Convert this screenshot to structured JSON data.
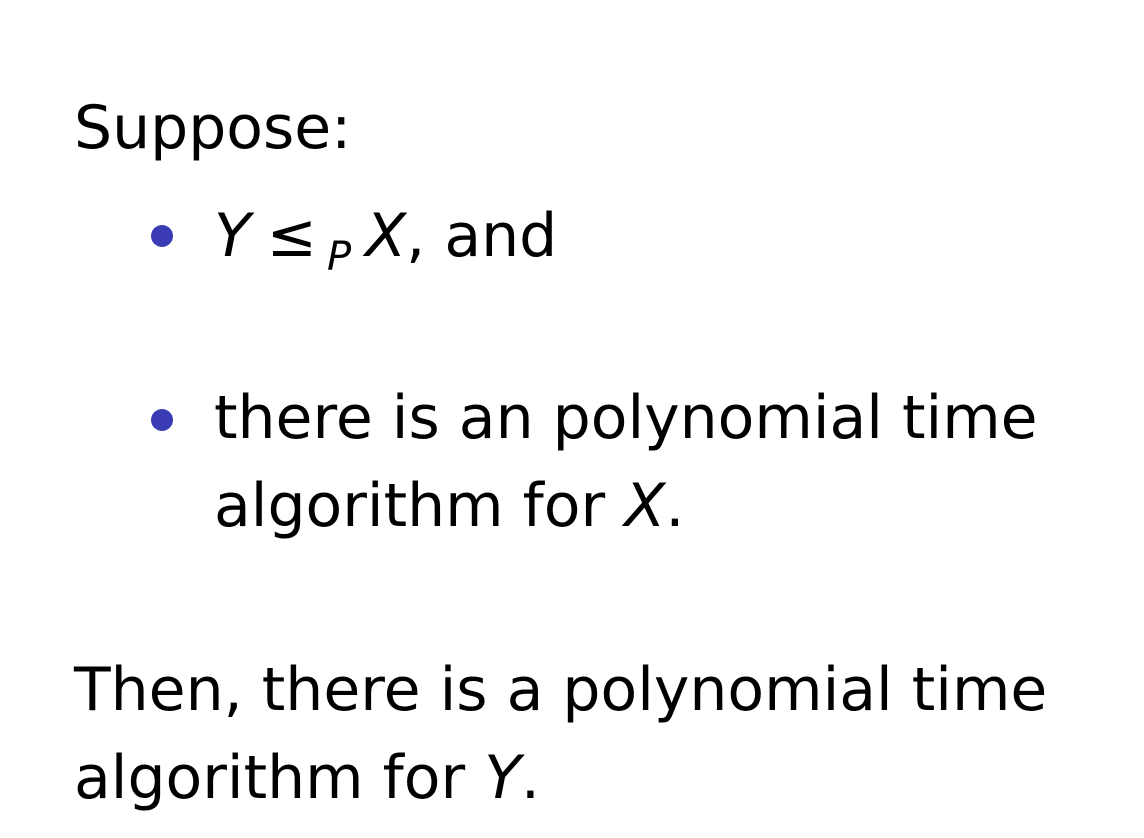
{
  "intro": "Suppose:",
  "bullets": [
    {
      "var_y": "Y",
      "relation": "≤",
      "subscript": "P",
      "var_x": "X",
      "tail": ", and"
    },
    {
      "line1": "there is an polynomial time",
      "line2_prefix": "algorithm for ",
      "line2_var": "X",
      "line2_suffix": "."
    }
  ],
  "conclusion": {
    "line1": "Then, there is a polynomial time",
    "line2_prefix": "algorithm for ",
    "line2_var": "Y",
    "line2_suffix": "."
  },
  "colors": {
    "bullet": "#3b3bb3",
    "text": "#000000",
    "background": "#ffffff"
  }
}
